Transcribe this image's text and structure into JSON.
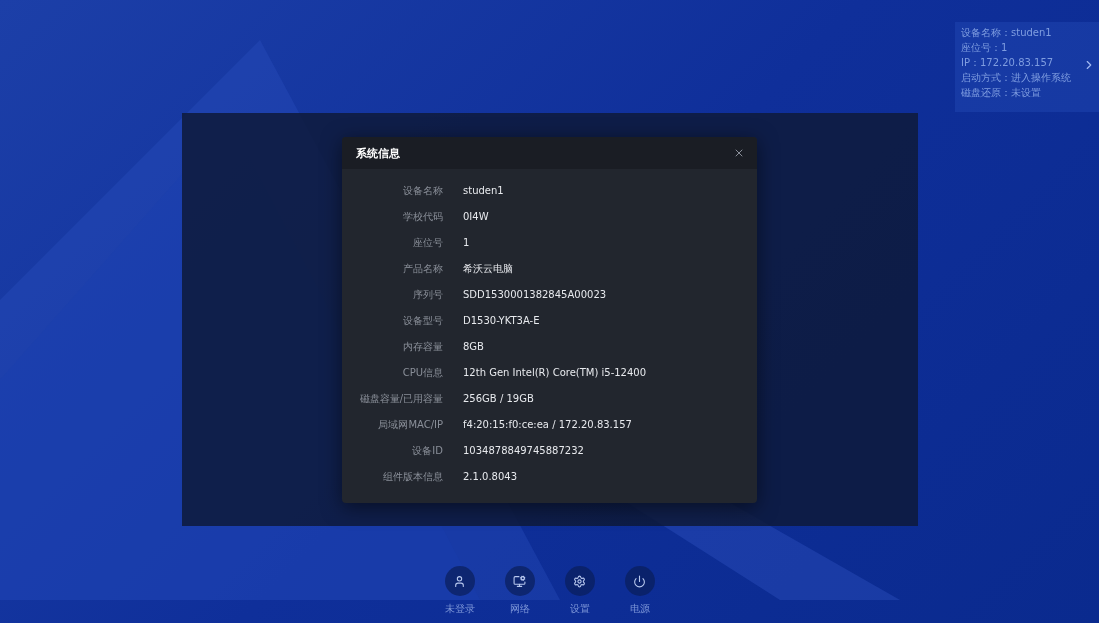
{
  "status_panel": {
    "lines": [
      "设备名称：studen1",
      "座位号：1",
      "IP：172.20.83.157",
      "启动方式：进入操作系统",
      "磁盘还原：未设置"
    ]
  },
  "dialog": {
    "title": "系统信息",
    "rows": [
      {
        "label": "设备名称",
        "value": "studen1"
      },
      {
        "label": "学校代码",
        "value": "0I4W"
      },
      {
        "label": "座位号",
        "value": "1"
      },
      {
        "label": "产品名称",
        "value": "希沃云电脑"
      },
      {
        "label": "序列号",
        "value": "SDD1530001382845A00023"
      },
      {
        "label": "设备型号",
        "value": "D1530-YKT3A-E"
      },
      {
        "label": "内存容量",
        "value": "8GB"
      },
      {
        "label": "CPU信息",
        "value": "12th Gen Intel(R) Core(TM) i5-12400"
      },
      {
        "label": "磁盘容量/已用容量",
        "value": "256GB / 19GB"
      },
      {
        "label": "局域网MAC/IP",
        "value": "f4:20:15:f0:ce:ea / 172.20.83.157"
      },
      {
        "label": "设备ID",
        "value": "1034878849745887232"
      },
      {
        "label": "组件版本信息",
        "value": "2.1.0.8043"
      }
    ]
  },
  "dock": [
    {
      "kind": "user",
      "label": "未登录"
    },
    {
      "kind": "network",
      "label": "网络"
    },
    {
      "kind": "settings",
      "label": "设置"
    },
    {
      "kind": "power",
      "label": "电源"
    }
  ]
}
